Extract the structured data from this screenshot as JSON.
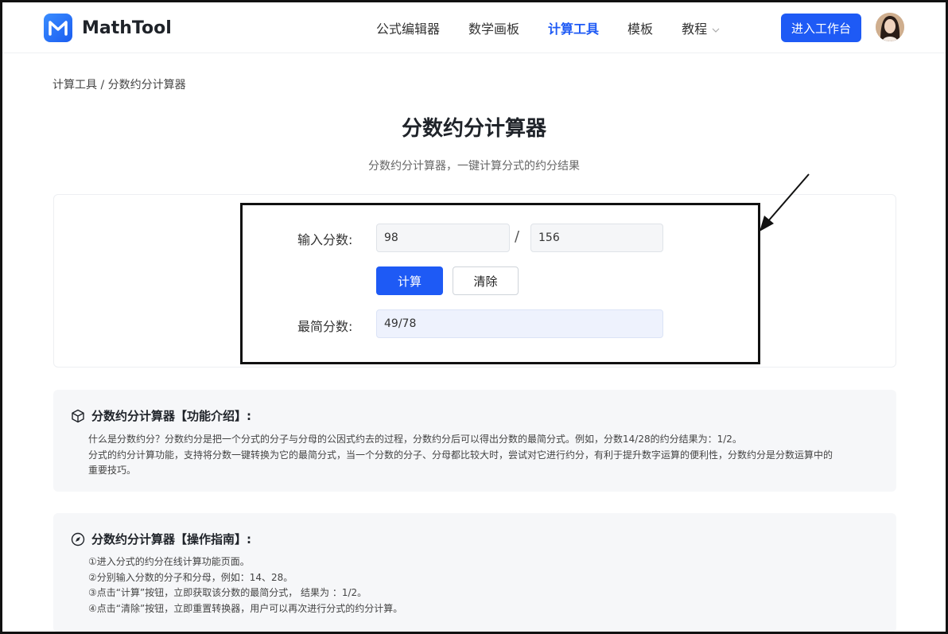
{
  "header": {
    "logo_text": "MathTool",
    "nav": [
      {
        "label": "公式编辑器"
      },
      {
        "label": "数学画板"
      },
      {
        "label": "计算工具",
        "active": true
      },
      {
        "label": "模板"
      },
      {
        "label": "教程",
        "has_dropdown": true
      }
    ],
    "workbench_button": "进入工作台"
  },
  "breadcrumb": "计算工具 / 分数约分计算器",
  "page": {
    "title": "分数约分计算器",
    "subtitle": "分数约分计算器，一键计算分式的约分结果"
  },
  "calculator": {
    "input_label": "输入分数:",
    "numerator": "98",
    "separator": "/",
    "denominator": "156",
    "calc_button": "计算",
    "clear_button": "清除",
    "result_label": "最简分数:",
    "result": "49/78"
  },
  "intro": {
    "title": "分数约分计算器【功能介绍】:",
    "icon": "cube-icon",
    "lines": [
      "什么是分数约分？分数约分是把一个分式的分子与分母的公因式约去的过程，分数约分后可以得出分数的最简分式。例如，分数14/28的约分结果为：1/2。",
      "分式的约分计算功能，支持将分数一键转换为它的最简分式，当一个分数的分子、分母都比较大时，尝试对它进行约分，有利于提升数字运算的便利性，分数约分是分数运算中的",
      "重要技巧。"
    ]
  },
  "guide": {
    "title": "分数约分计算器【操作指南】:",
    "icon": "compass-icon",
    "lines": [
      "①进入分式的约分在线计算功能页面。",
      "②分别输入分数的分子和分母，例如：14、28。",
      "③点击“计算”按钮，立即获取该分数的最简分式， 结果为 ：1/2。",
      "④点击“清除”按钮，立即重置转换器，用户可以再次进行分式的约分计算。"
    ]
  },
  "colors": {
    "accent": "#1e5af5",
    "panel_bg": "#f6f7f9",
    "result_bg": "#eef2fd"
  }
}
